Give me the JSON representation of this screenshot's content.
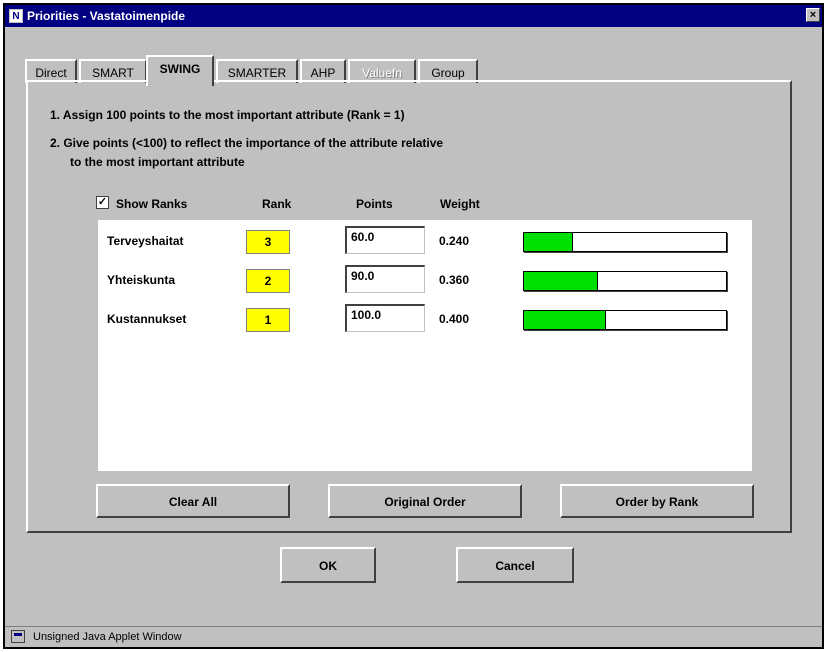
{
  "window": {
    "title": "Priorities - Vastatoimenpide",
    "app_icon": "N",
    "close_label": "×"
  },
  "tabs": [
    {
      "label": "Direct",
      "state": "normal"
    },
    {
      "label": "SMART",
      "state": "normal"
    },
    {
      "label": "SWING",
      "state": "active"
    },
    {
      "label": "SMARTER",
      "state": "normal"
    },
    {
      "label": "AHP",
      "state": "normal"
    },
    {
      "label": "Valuefn",
      "state": "disabled"
    },
    {
      "label": "Group",
      "state": "normal"
    }
  ],
  "instructions": {
    "line1": "1. Assign 100 points to the most important attribute (Rank = 1)",
    "line2a": "2. Give points (<100) to reflect the importance of the attribute relative",
    "line2b": "to the most important attribute"
  },
  "columns": {
    "show_ranks_label": "Show Ranks",
    "show_ranks_checked": true,
    "check_mark": "✓",
    "rank": "Rank",
    "points": "Points",
    "weight": "Weight"
  },
  "attributes": [
    {
      "name": "Terveyshaitat",
      "rank": "3",
      "points": "60.0",
      "weight": "0.240",
      "weight_fraction": 0.24
    },
    {
      "name": "Yhteiskunta",
      "rank": "2",
      "points": "90.0",
      "weight": "0.360",
      "weight_fraction": 0.36
    },
    {
      "name": "Kustannukset",
      "rank": "1",
      "points": "100.0",
      "weight": "0.400",
      "weight_fraction": 0.4
    }
  ],
  "buttons": {
    "clear_all": "Clear All",
    "original_order": "Original Order",
    "order_by_rank": "Order by Rank",
    "ok": "OK",
    "cancel": "Cancel"
  },
  "status": {
    "text": "Unsigned Java Applet Window"
  },
  "colors": {
    "rank_highlight": "#ffff00",
    "weight_bar": "#00e000",
    "titlebar": "#000080"
  }
}
